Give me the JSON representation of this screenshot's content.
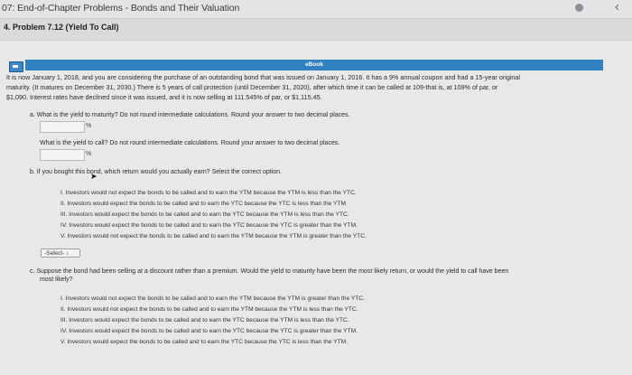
{
  "header": {
    "title": "07: End-of-Chapter Problems - Bonds and Their Valuation",
    "problem_label": "4. Problem 7.12 (Yield To Call)"
  },
  "ebook": {
    "label": "eBook",
    "icon": "ebook-icon"
  },
  "intro": {
    "line1": "It is now January 1, 2018, and you are considering the purchase of an outstanding bond that was issued on January 1, 2016. It has a 9% annual coupon and had a 15-year original",
    "line2": "maturity. (It matures on December 31, 2030.) There is 5 years of call protection (until December 31, 2020), after which time it can be called at 109-that is, at 109% of par, or",
    "line3": "$1,090. Interest rates have declined since it was issued, and it is now selling at 111.545% of par, or $1,115.45."
  },
  "part_a": {
    "q1": "a. What is the yield to maturity? Do not round intermediate calculations. Round your answer to two decimal places.",
    "ytm_value": "",
    "ytm_unit": "%",
    "q2": "What is the yield to call? Do not round intermediate calculations. Round your answer to two decimal places.",
    "ytc_value": "",
    "ytc_unit": "%"
  },
  "part_b": {
    "question": "b. If you bought this bond, which return would you actually earn? Select the correct option.",
    "options": [
      "I. Investors would not expect the bonds to be called and to earn the YTM because the YTM is less than the YTC.",
      "II. Investors would expect the bonds to be called and to earn the YTC because the YTC is less than the YTM.",
      "III. Investors would expect the bonds to be called and to earn the YTC because the YTM is less than the YTC.",
      "IV. Investors would expect the bonds to be called and to earn the YTC because the YTC is greater than the YTM.",
      "V. Investors would not expect the bonds to be called and to earn the YTM because the YTM is greater than the YTC."
    ],
    "select_label": "-Select- ↕"
  },
  "part_c": {
    "question_l1": "c. Suppose the bond had been selling at a discount rather than a premium. Would the yield to maturity have been the most likely return, or would the yield to call have been",
    "question_l2": "most likely?",
    "options": [
      "I. Investors would not expect the bonds to be called and to earn the YTM because the YTM is greater than the YTC.",
      "II. Investors would not expect the bonds to be called and to earn the YTM because the YTM is less than the YTC.",
      "III. Investors would expect the bonds to be called and to earn the YTC because the YTM is less than the YTC.",
      "IV. Investors would expect the bonds to be called and to earn the YTC because the YTC is greater than the YTM.",
      "V. Investors would expect the bonds to be called and to earn the YTC because the YTC is less than the YTM."
    ]
  }
}
